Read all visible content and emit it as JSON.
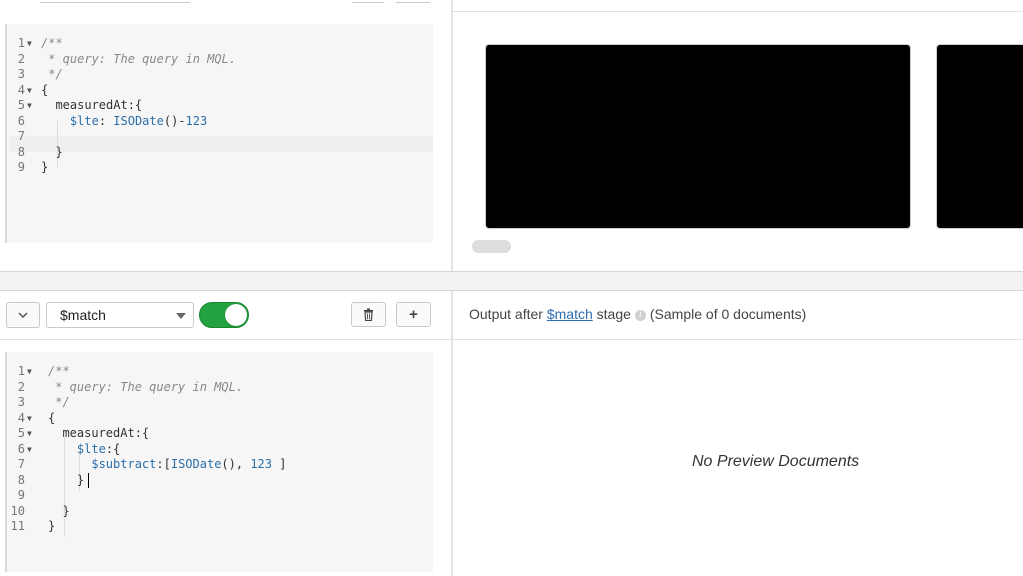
{
  "stage1": {
    "editor_lines": [
      {
        "n": "1",
        "fold": true,
        "segments": [
          {
            "t": "/**",
            "c": "cm"
          }
        ]
      },
      {
        "n": "2",
        "fold": false,
        "segments": [
          {
            "t": " * query: The query in MQL.",
            "c": "cm"
          }
        ]
      },
      {
        "n": "3",
        "fold": false,
        "segments": [
          {
            "t": " */",
            "c": "cm"
          }
        ]
      },
      {
        "n": "4",
        "fold": true,
        "segments": [
          {
            "t": "{",
            "c": ""
          }
        ]
      },
      {
        "n": "5",
        "fold": true,
        "segments": [
          {
            "t": "  measuredAt:{",
            "c": ""
          }
        ]
      },
      {
        "n": "6",
        "fold": false,
        "segments": [
          {
            "t": "    ",
            "c": ""
          },
          {
            "t": "$lte",
            "c": "kw"
          },
          {
            "t": ": ",
            "c": ""
          },
          {
            "t": "ISODate",
            "c": "fn"
          },
          {
            "t": "()-",
            "c": ""
          },
          {
            "t": "123",
            "c": "num"
          }
        ]
      },
      {
        "n": "7",
        "fold": false,
        "segments": [
          {
            "t": "",
            "c": ""
          }
        ]
      },
      {
        "n": "8",
        "fold": false,
        "segments": [
          {
            "t": "  }",
            "c": ""
          }
        ]
      },
      {
        "n": "9",
        "fold": false,
        "segments": [
          {
            "t": "}",
            "c": ""
          }
        ]
      }
    ]
  },
  "stage2": {
    "operator": "$match",
    "enabled": true,
    "delete_icon": "trash-icon",
    "add_label": "+",
    "collapse_icon": "chevron-down-icon",
    "editor_lines": [
      {
        "n": "1",
        "fold": true,
        "segments": [
          {
            "t": "/**",
            "c": "cm"
          }
        ]
      },
      {
        "n": "2",
        "fold": false,
        "segments": [
          {
            "t": " * query: The query in MQL.",
            "c": "cm"
          }
        ]
      },
      {
        "n": "3",
        "fold": false,
        "segments": [
          {
            "t": " */",
            "c": "cm"
          }
        ]
      },
      {
        "n": "4",
        "fold": true,
        "segments": [
          {
            "t": "{",
            "c": ""
          }
        ]
      },
      {
        "n": "5",
        "fold": true,
        "segments": [
          {
            "t": "  measuredAt:{",
            "c": ""
          }
        ]
      },
      {
        "n": "6",
        "fold": true,
        "segments": [
          {
            "t": "    ",
            "c": ""
          },
          {
            "t": "$lte",
            "c": "kw"
          },
          {
            "t": ":{",
            "c": ""
          }
        ]
      },
      {
        "n": "7",
        "fold": false,
        "segments": [
          {
            "t": "      ",
            "c": ""
          },
          {
            "t": "$subtract",
            "c": "kw"
          },
          {
            "t": ":[",
            "c": ""
          },
          {
            "t": "ISODate",
            "c": "fn"
          },
          {
            "t": "(), ",
            "c": ""
          },
          {
            "t": "123",
            "c": "num"
          },
          {
            "t": " ]",
            "c": ""
          }
        ]
      },
      {
        "n": "8",
        "fold": false,
        "segments": [
          {
            "t": "    }",
            "c": ""
          }
        ]
      },
      {
        "n": "9",
        "fold": false,
        "segments": [
          {
            "t": "",
            "c": ""
          }
        ]
      },
      {
        "n": "10",
        "fold": false,
        "segments": [
          {
            "t": "  }",
            "c": ""
          }
        ]
      },
      {
        "n": "11",
        "fold": false,
        "segments": [
          {
            "t": "}",
            "c": ""
          }
        ]
      }
    ],
    "output": {
      "prefix": "Output after",
      "stage_link": "$match",
      "suffix": "stage",
      "sample": "(Sample of 0 documents)"
    },
    "empty_message": "No Preview Documents"
  },
  "colors": {
    "toggle_on": "#23a240",
    "link": "#2e6eb3",
    "editor_bg": "#f6f6f6"
  }
}
